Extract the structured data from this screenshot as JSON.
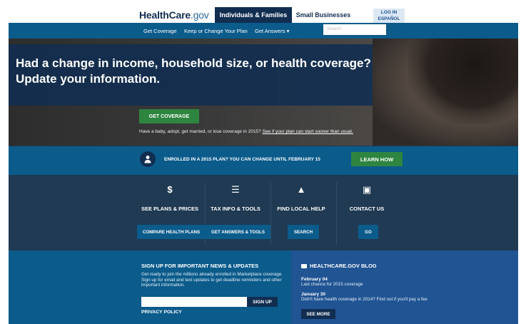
{
  "header": {
    "logo_main": "HealthCare",
    "logo_gov": ".gov",
    "tabs": [
      "Individuals & Families",
      "Small Businesses"
    ],
    "login": "LOG IN",
    "espanol": "ESPAÑOL"
  },
  "nav": {
    "items": [
      "Get Coverage",
      "Keep or Change Your Plan",
      "Get Answers ▾"
    ],
    "search_placeholder": "Search"
  },
  "hero": {
    "title_line1": "Had a change in income, household size, or health coverage?",
    "title_line2": "Update your information.",
    "cta": "GET COVERAGE",
    "note_prefix": "Have a baby, adopt, get married, or lose coverage in 2015?",
    "note_link": "See if your plan can start sooner than usual."
  },
  "band": {
    "text": "ENROLLED IN A 2015 PLAN? YOU CAN CHANGE UNTIL FEBRUARY 15",
    "button": "LEARN HOW"
  },
  "features": [
    {
      "icon": "$",
      "icon_name": "dollar-icon",
      "label": "SEE PLANS & PRICES",
      "sub": "COMPARE HEALTH PLANS"
    },
    {
      "icon": "☰",
      "icon_name": "list-icon",
      "label": "TAX INFO & TOOLS",
      "sub": "GET ANSWERS & TOOLS"
    },
    {
      "icon": "▲",
      "icon_name": "road-icon",
      "label": "FIND LOCAL HELP",
      "sub": "SEARCH"
    },
    {
      "icon": "▣",
      "icon_name": "contact-icon",
      "label": "CONTACT US",
      "sub": "GO"
    }
  ],
  "signup": {
    "title": "SIGN UP FOR IMPORTANT NEWS & UPDATES",
    "text": "Get ready to join the millions already enrolled in Marketplace coverage. Sign up for email and text updates to get deadline reminders and other important information.",
    "button": "SIGN UP",
    "privacy": "PRIVACY POLICY"
  },
  "blog": {
    "title": "HEALTHCARE.GOV BLOG",
    "posts": [
      {
        "date": "February 04",
        "text": "Last chance for 2015 coverage"
      },
      {
        "date": "January 30",
        "text": "Didn't have health coverage in 2014? Find out if you'll pay a fee"
      }
    ],
    "see_more": "SEE MORE"
  },
  "colors": {
    "navy": "#112e51",
    "blue": "#0b5b8b",
    "green": "#2e8540"
  }
}
